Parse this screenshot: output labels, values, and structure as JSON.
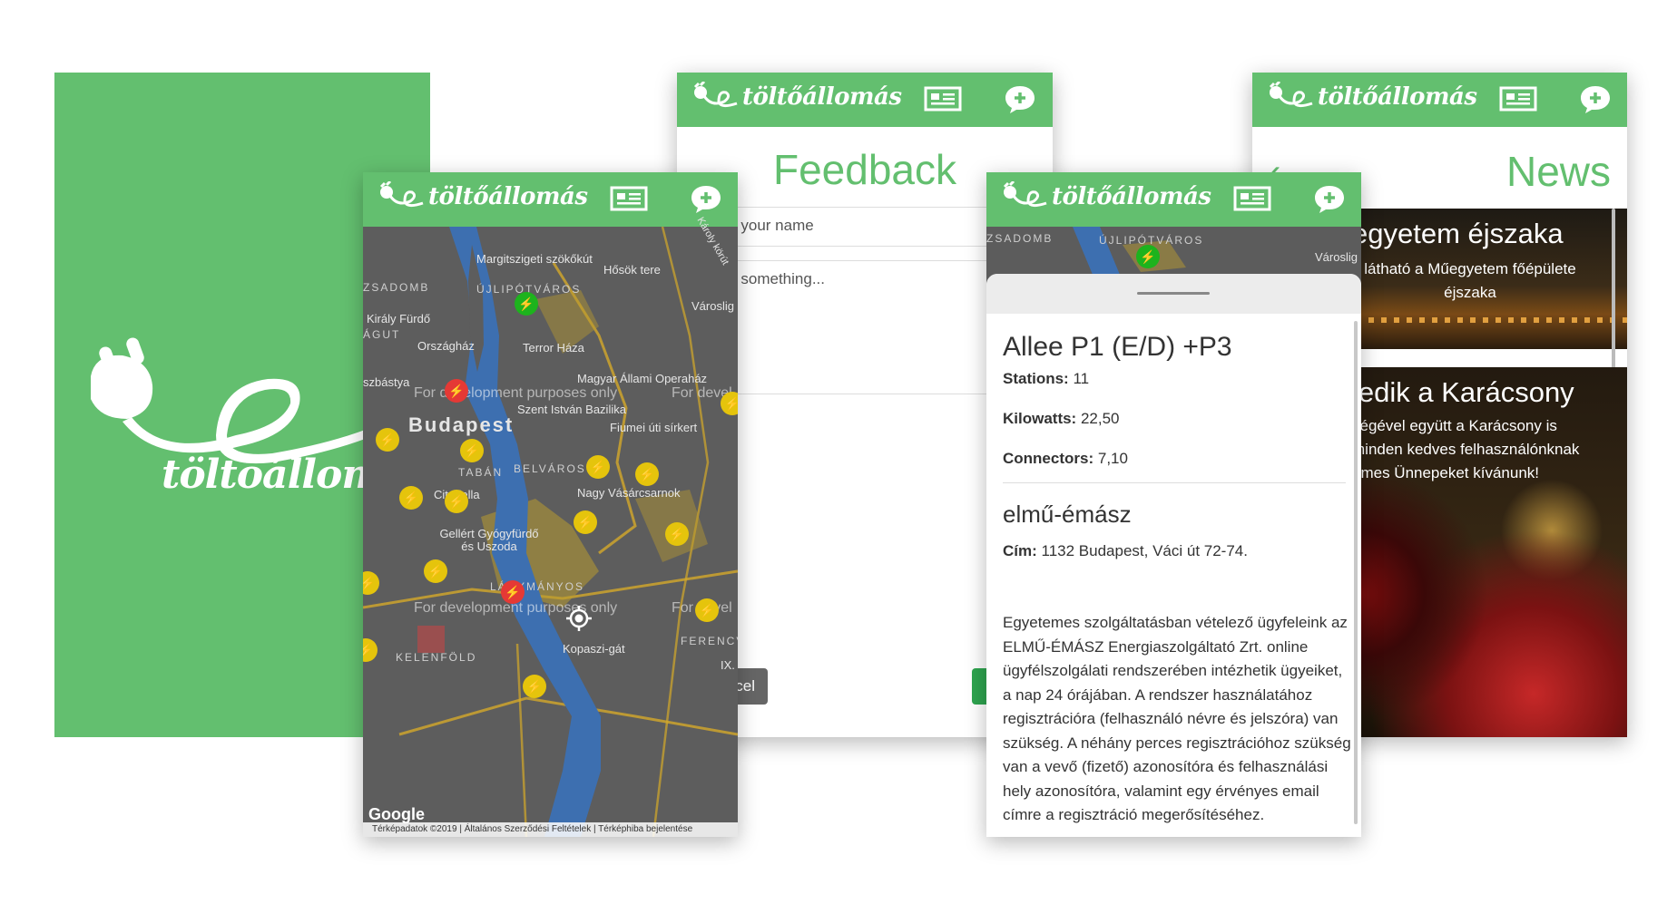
{
  "brand": {
    "name": "töltőállomás",
    "accent": "#63bf6f"
  },
  "icons": [
    "plug-logo-icon",
    "news-icon",
    "add-comment-icon",
    "back-chevron-icon",
    "location-icon",
    "charger-bolt-icon"
  ],
  "feedback": {
    "title": "Feedback",
    "name_placeholder": "r your name",
    "message_placeholder": "r something...",
    "cancel_label": "cel"
  },
  "news": {
    "title": "News",
    "items": [
      {
        "title": "egyetem éjszaka",
        "text": "látható a Műegyetem főépülete éjszaka"
      },
      {
        "title": "ledik a Karácsony",
        "text": "végével együtt a Karácsony is minden kedves felhasználónknak emes Ünnepeket kívánunk!"
      }
    ]
  },
  "map": {
    "labels": {
      "margit": "Margitszigeti szökőkút",
      "hosok": "Hősök tere",
      "zsadomb": "ZSADOMB",
      "ujlipot": "ÚJLIPÓTVÁROS",
      "kiraly": "Király Fürdő",
      "agut": "ÁGUT",
      "orszaghaz": "Országház",
      "terror": "Terror Háza",
      "varosliget": "Városlig",
      "bastya": "szbástya",
      "opera": "Magyar Állami Operaház",
      "bazilika": "Szent István Bazilika",
      "budapest": "Budapest",
      "fiumei": "Fiumei úti sírkert",
      "taban": "TABÁN",
      "belvaros": "BELVÁROS",
      "citadella": "Citadella",
      "nagy": "Nagy Vásárcsarnok",
      "gellert": "Gellért Gyógyfürdő és Uszoda",
      "lagymanyos": "LÁGYMÁNYOS",
      "ferencvaros": "FERENCVÁR",
      "kopaszi": "Kopaszi-gát",
      "kelenfold": "KELENFÖLD",
      "ix": "IX.",
      "karoly": "Károly körút"
    },
    "dev_watermark": "For development purposes only",
    "dev_short": "For devel",
    "google": "Google",
    "footer": "Térképadatok ©2019  |  Általános Szerződési Feltételek  |  Térképhiba bejelentése"
  },
  "detail": {
    "map_labels": {
      "zsadomb": "ZSADOMB",
      "ujlipot": "ÚJLIPÓTVÁROS",
      "varosliget": "Városlig"
    },
    "station_name": "Allee P1 (E/D) +P3",
    "stations_label": "Stations:",
    "stations_value": "11",
    "kilowatts_label": "Kilowatts:",
    "kilowatts_value": "22,50",
    "connectors_label": "Connectors:",
    "connectors_value": "7,10",
    "operator": "elmű-émász",
    "address_label": "Cím:",
    "address_value": "1132 Budapest, Váci út 72-74.",
    "description": "Egyetemes szolgáltatásban vételező ügyfeleink az ELMŰ-ÉMÁSZ Energiaszolgáltató Zrt. online ügyfélszolgálati rendszerében intézhetik ügyeiket, a nap 24 órájában. A rendszer használatához regisztrációra (felhasználó névre és jelszóra) van szükség. A néhány perces regisztrációhoz szükség van a vevő (fizető) azonosítóra és felhasználási hely azonosítóra, valamint egy érvényes email címre a regisztráció megerősítéséhez."
  }
}
